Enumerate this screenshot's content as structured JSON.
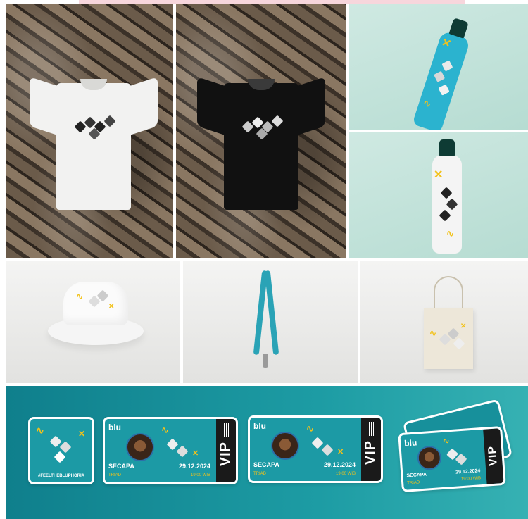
{
  "tickets": [
    {
      "brand": "blu",
      "venue": "SECAPA",
      "date": "29.12.2024",
      "sub_left": "TRIAD",
      "sub_right": "19:00 WIB",
      "stub": "VIP"
    },
    {
      "brand": "blu",
      "venue": "SECAPA",
      "date": "29.12.2024",
      "sub_left": "TRIAD",
      "sub_right": "19:00 WIB",
      "stub": "VIP"
    },
    {
      "brand": "blu",
      "venue": "SECAPA",
      "date": "29.12.2024",
      "sub_left": "TRIAD",
      "sub_right": "19:00 WIB",
      "stub": "VIP"
    }
  ],
  "sticker": {
    "hashtag": "#FEELTHEBLUPHORIA"
  },
  "colors": {
    "teal": "#1c9aa5",
    "yellow": "#f2c21b",
    "mint": "#cfe9e2"
  }
}
